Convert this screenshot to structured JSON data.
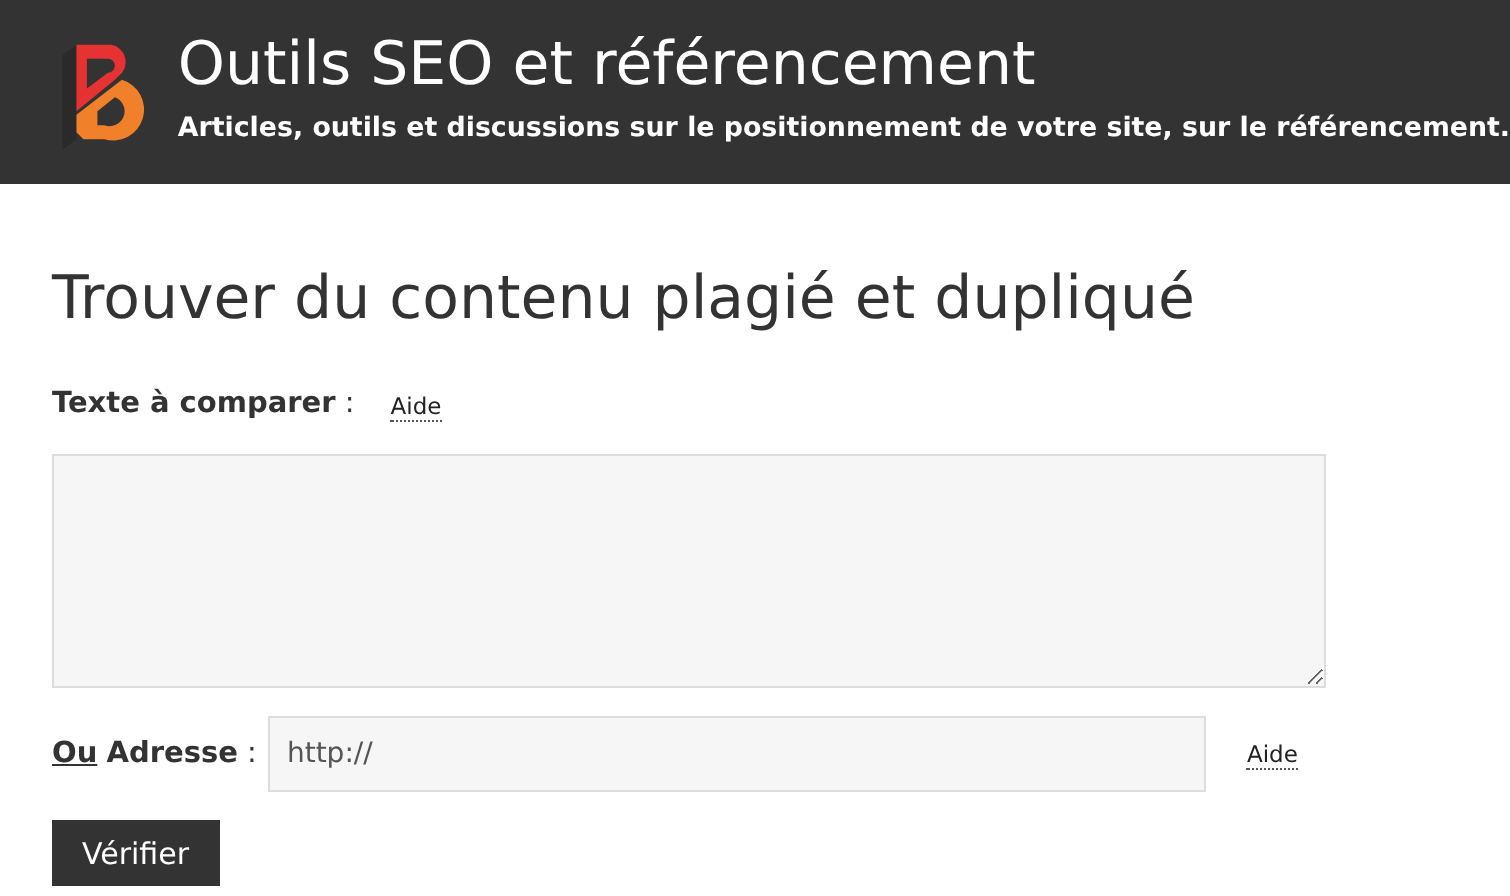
{
  "header": {
    "title": "Outils SEO et référencement",
    "subtitle": "Articles, outils et discussions sur le positionnement de votre site, sur le référencement."
  },
  "page_title": "Trouver du contenu plagié et dupliqué",
  "text_field": {
    "label": "**Texte à comparer** :",
    "help": "Aide"
  },
  "address_field": {
    "label_underlined": "Ou",
    "label": "**Adresse** :",
    "value": "http://",
    "help": "Aide"
  },
  "button": "Vérifier"
}
